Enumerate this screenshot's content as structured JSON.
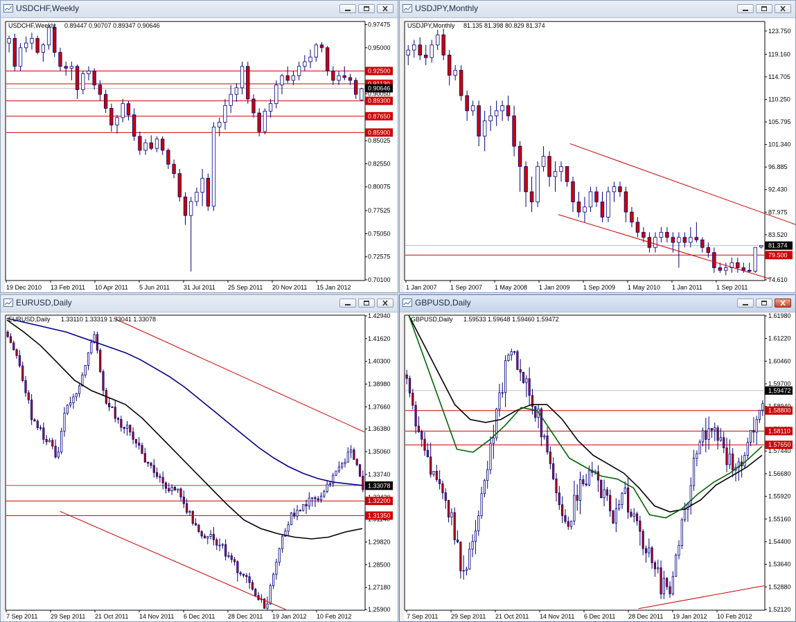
{
  "colors": {
    "level_line": "#cc0000",
    "trend_line": "#cc0000",
    "bear_body": "#cc0000",
    "bull_body": "#ffffff",
    "wick": "#000080",
    "price_tag": "#000000",
    "ma_black": "#000000",
    "ma_blue": "#00008b",
    "ma_green": "#006400"
  },
  "windows": [
    {
      "title": "USDCHF,Weekly",
      "info_symbol": "USDCHF,Weekly",
      "ohlc_text": "0.89447 0.90707 0.89347 0.90646",
      "active": false
    },
    {
      "title": "USDJPY,Monthly",
      "info_symbol": "USDJPY,Monthly",
      "ohlc_text": "81.135 81.398 80.829 81.374",
      "active": false
    },
    {
      "title": "EURUSD,Daily",
      "info_symbol": "EURUSD,Daily",
      "ohlc_text": "1.33110 1.33319 1.33041 1.33078",
      "active": false
    },
    {
      "title": "GBPUSD,Daily",
      "info_symbol": "GBPUSD,Daily",
      "ohlc_text": "1.59533 1.59648 1.59460 1.59472",
      "active": true
    }
  ],
  "chart_data": [
    {
      "type": "candlestick",
      "symbol": "USDCHF",
      "timeframe": "Weekly",
      "ylim": [
        0.701,
        0.9774
      ],
      "y_ticks": [
        "0.97475",
        "0.95000",
        "0.92500",
        "0.90050",
        "0.87750",
        "0.85025",
        "0.82550",
        "0.80075",
        "0.77525",
        "0.75050",
        "0.72575",
        "0.70100"
      ],
      "x_ticks": [
        "19 Dec 2010",
        "13 Feb 2011",
        "10 Apr 2011",
        "5 Jun 2011",
        "31 Jul 2011",
        "25 Sep 2011",
        "20 Nov 2011",
        "15 Jan 2012"
      ],
      "levels": [
        {
          "value": 0.925,
          "label": "0.92500"
        },
        {
          "value": 0.9113,
          "label": "0.91130"
        },
        {
          "value": 0.893,
          "label": "0.89300"
        },
        {
          "value": 0.8765,
          "label": "0.87650"
        },
        {
          "value": 0.859,
          "label": "0.85900"
        }
      ],
      "trendlines": [],
      "current_price": 0.90646,
      "candles": [
        [
          0.955,
          0.963,
          0.945,
          0.96
        ],
        [
          0.96,
          0.965,
          0.925,
          0.93
        ],
        [
          0.93,
          0.955,
          0.925,
          0.95
        ],
        [
          0.95,
          0.962,
          0.945,
          0.955
        ],
        [
          0.955,
          0.966,
          0.948,
          0.96
        ],
        [
          0.96,
          0.963,
          0.943,
          0.945
        ],
        [
          0.945,
          0.955,
          0.935,
          0.953
        ],
        [
          0.953,
          0.975,
          0.948,
          0.972
        ],
        [
          0.972,
          0.976,
          0.94,
          0.945
        ],
        [
          0.945,
          0.95,
          0.925,
          0.93
        ],
        [
          0.93,
          0.935,
          0.92,
          0.928
        ],
        [
          0.928,
          0.935,
          0.915,
          0.93
        ],
        [
          0.93,
          0.932,
          0.895,
          0.905
        ],
        [
          0.905,
          0.925,
          0.9,
          0.922
        ],
        [
          0.922,
          0.93,
          0.915,
          0.925
        ],
        [
          0.925,
          0.928,
          0.905,
          0.91
        ],
        [
          0.91,
          0.915,
          0.893,
          0.9
        ],
        [
          0.9,
          0.905,
          0.88,
          0.885
        ],
        [
          0.885,
          0.89,
          0.86,
          0.867
        ],
        [
          0.867,
          0.878,
          0.858,
          0.875
        ],
        [
          0.875,
          0.895,
          0.87,
          0.89
        ],
        [
          0.89,
          0.893,
          0.872,
          0.878
        ],
        [
          0.878,
          0.885,
          0.85,
          0.855
        ],
        [
          0.855,
          0.86,
          0.835,
          0.84
        ],
        [
          0.84,
          0.852,
          0.835,
          0.848
        ],
        [
          0.848,
          0.856,
          0.84,
          0.842
        ],
        [
          0.842,
          0.855,
          0.838,
          0.852
        ],
        [
          0.852,
          0.855,
          0.835,
          0.84
        ],
        [
          0.84,
          0.842,
          0.82,
          0.825
        ],
        [
          0.825,
          0.83,
          0.81,
          0.815
        ],
        [
          0.815,
          0.82,
          0.785,
          0.79
        ],
        [
          0.79,
          0.795,
          0.76,
          0.77
        ],
        [
          0.77,
          0.79,
          0.71,
          0.785
        ],
        [
          0.785,
          0.8,
          0.78,
          0.795
        ],
        [
          0.795,
          0.82,
          0.78,
          0.81
        ],
        [
          0.81,
          0.815,
          0.775,
          0.78
        ],
        [
          0.78,
          0.87,
          0.775,
          0.865
        ],
        [
          0.865,
          0.875,
          0.855,
          0.87
        ],
        [
          0.87,
          0.895,
          0.862,
          0.888
        ],
        [
          0.888,
          0.91,
          0.88,
          0.9
        ],
        [
          0.9,
          0.912,
          0.892,
          0.907
        ],
        [
          0.907,
          0.935,
          0.9,
          0.93
        ],
        [
          0.93,
          0.935,
          0.89,
          0.895
        ],
        [
          0.895,
          0.9,
          0.875,
          0.88
        ],
        [
          0.88,
          0.885,
          0.855,
          0.86
        ],
        [
          0.86,
          0.885,
          0.857,
          0.882
        ],
        [
          0.882,
          0.895,
          0.875,
          0.89
        ],
        [
          0.89,
          0.915,
          0.885,
          0.91
        ],
        [
          0.91,
          0.922,
          0.9,
          0.92
        ],
        [
          0.92,
          0.93,
          0.912,
          0.915
        ],
        [
          0.915,
          0.925,
          0.91,
          0.92
        ],
        [
          0.92,
          0.935,
          0.915,
          0.93
        ],
        [
          0.93,
          0.942,
          0.925,
          0.935
        ],
        [
          0.935,
          0.948,
          0.928,
          0.94
        ],
        [
          0.94,
          0.955,
          0.935,
          0.953
        ],
        [
          0.953,
          0.956,
          0.945,
          0.95
        ],
        [
          0.95,
          0.952,
          0.92,
          0.925
        ],
        [
          0.925,
          0.93,
          0.91,
          0.915
        ],
        [
          0.915,
          0.925,
          0.91,
          0.92
        ],
        [
          0.92,
          0.93,
          0.915,
          0.918
        ],
        [
          0.918,
          0.922,
          0.91,
          0.915
        ],
        [
          0.915,
          0.918,
          0.895,
          0.9
        ],
        [
          0.894,
          0.907,
          0.893,
          0.906
        ]
      ]
    },
    {
      "type": "candlestick",
      "symbol": "USDJPY",
      "timeframe": "Monthly",
      "ylim": [
        74.61,
        125.5
      ],
      "y_ticks": [
        "123.750",
        "119.160",
        "114.705",
        "110.250",
        "105.795",
        "101.340",
        "96.885",
        "92.430",
        "87.975",
        "83.520",
        "79.065",
        "74.610"
      ],
      "x_ticks": [
        "1 Jan 2007",
        "1 Sep 2007",
        "1 May 2008",
        "1 Jan 2009",
        "1 Sep 2009",
        "1 May 2010",
        "1 Jan 2011",
        "1 Sep 2011"
      ],
      "levels": [
        {
          "value": 79.5,
          "label": "79.500"
        }
      ],
      "trendlines": [
        [
          [
            28,
            101.5
          ],
          [
            70,
            84
          ]
        ],
        [
          [
            26,
            87.5
          ],
          [
            62,
            74.8
          ]
        ]
      ],
      "current_price": 81.374,
      "candles": [
        [
          119,
          121,
          117,
          120
        ],
        [
          120,
          122,
          118.5,
          121
        ],
        [
          121,
          122.5,
          118,
          119
        ],
        [
          119,
          121,
          117,
          118.5
        ],
        [
          118.5,
          122,
          117.5,
          121
        ],
        [
          121,
          124,
          120,
          123
        ],
        [
          123,
          124.2,
          118,
          119
        ],
        [
          119,
          120,
          113,
          115
        ],
        [
          115,
          117,
          114,
          116
        ],
        [
          116,
          117,
          110,
          111
        ],
        [
          111,
          112,
          106,
          108
        ],
        [
          108,
          110,
          107,
          109
        ],
        [
          109,
          110,
          101,
          103
        ],
        [
          103,
          108,
          100,
          106
        ],
        [
          106,
          109,
          104,
          107
        ],
        [
          107,
          110,
          105,
          108
        ],
        [
          108,
          110,
          106,
          109
        ],
        [
          109,
          111,
          106,
          107
        ],
        [
          107,
          109,
          99,
          101
        ],
        [
          101,
          102,
          92,
          97
        ],
        [
          97,
          98,
          89,
          92
        ],
        [
          92,
          95,
          88,
          90
        ],
        [
          90,
          98,
          89,
          97
        ],
        [
          97,
          101,
          96,
          99
        ],
        [
          99,
          100,
          93,
          95
        ],
        [
          95,
          98,
          92,
          96
        ],
        [
          96,
          98,
          94,
          97
        ],
        [
          97,
          97,
          93,
          94
        ],
        [
          94,
          95,
          88,
          90
        ],
        [
          90,
          92,
          87,
          88
        ],
        [
          88,
          91,
          86,
          89
        ],
        [
          89,
          93,
          88,
          92
        ],
        [
          92,
          93,
          89,
          90
        ],
        [
          90,
          92,
          86,
          87
        ],
        [
          87,
          93,
          86,
          92
        ],
        [
          92,
          94,
          90,
          93
        ],
        [
          93,
          94,
          91,
          92
        ],
        [
          92,
          93,
          86,
          88
        ],
        [
          88,
          89,
          85,
          86
        ],
        [
          86,
          87,
          83,
          84
        ],
        [
          84,
          85,
          82,
          83
        ],
        [
          83,
          84,
          80,
          81
        ],
        [
          81,
          84,
          80,
          83
        ],
        [
          83,
          85,
          82,
          84
        ],
        [
          84,
          85,
          82,
          83
        ],
        [
          83,
          84,
          80,
          82
        ],
        [
          82,
          84,
          77,
          83
        ],
        [
          83,
          84,
          81,
          82
        ],
        [
          82,
          85,
          81,
          83
        ],
        [
          83,
          86,
          82,
          82.5
        ],
        [
          82.5,
          83,
          80,
          81
        ],
        [
          81,
          82,
          79,
          80
        ],
        [
          80,
          81,
          76,
          77
        ],
        [
          77,
          78,
          76,
          76.5
        ],
        [
          76.5,
          78,
          75.5,
          77
        ],
        [
          77,
          79,
          76,
          78
        ],
        [
          78,
          79,
          76,
          77
        ],
        [
          77,
          78,
          76,
          76.5
        ],
        [
          76.5,
          78,
          76,
          76.3
        ],
        [
          76.3,
          81,
          76,
          81
        ],
        [
          81.1,
          81.4,
          80.8,
          81.37
        ]
      ]
    },
    {
      "type": "candlestick",
      "symbol": "EURUSD",
      "timeframe": "Daily",
      "ylim": [
        1.259,
        1.4294
      ],
      "y_ticks": [
        "1.42940",
        "1.41620",
        "1.40300",
        "1.38980",
        "1.37660",
        "1.36380",
        "1.35060",
        "1.33740",
        "1.32420",
        "1.31140",
        "1.29820",
        "1.28500",
        "1.27180",
        "1.25900"
      ],
      "x_ticks": [
        "7 Sep 2011",
        "29 Sep 2011",
        "21 Oct 2011",
        "14 Nov 2011",
        "6 Dec 2011",
        "28 Dec 2011",
        "19 Jan 2012",
        "10 Feb 2012"
      ],
      "levels": [
        {
          "value": 1.331,
          "label": "1.33100"
        },
        {
          "value": 1.322,
          "label": "1.32200"
        },
        {
          "value": 1.3135,
          "label": "1.31350"
        }
      ],
      "trendlines": [
        [
          [
            0.3,
            1.428
          ],
          [
            1,
            1.362
          ]
        ],
        [
          [
            0.15,
            1.316
          ],
          [
            0.78,
            1.259
          ]
        ]
      ],
      "current_price": 1.33078,
      "ma_series": [
        {
          "color": "#00008b",
          "values": [
            1.428,
            1.426,
            1.424,
            1.422,
            1.42,
            1.417,
            1.414,
            1.411,
            1.408,
            1.404,
            1.399,
            1.394,
            1.388,
            1.381,
            1.374,
            1.367,
            1.36,
            1.353,
            1.347,
            1.342,
            1.338,
            1.335,
            1.333,
            1.332,
            1.331
          ]
        },
        {
          "color": "#000000",
          "values": [
            1.427,
            1.42,
            1.412,
            1.402,
            1.392,
            1.386,
            1.382,
            1.378,
            1.37,
            1.36,
            1.35,
            1.34,
            1.33,
            1.32,
            1.311,
            1.306,
            1.303,
            1.301,
            1.3,
            1.301,
            1.304,
            1.306
          ]
        }
      ]
    },
    {
      "type": "candlestick",
      "symbol": "GBPUSD",
      "timeframe": "Daily",
      "ylim": [
        1.5212,
        1.6198
      ],
      "y_ticks": [
        "1.61980",
        "1.61220",
        "1.60460",
        "1.59700",
        "1.58940",
        "1.58180",
        "1.57440",
        "1.56680",
        "1.55920",
        "1.55160",
        "1.54400",
        "1.53640",
        "1.52880",
        "1.52120"
      ],
      "x_ticks": [
        "7 Sep 2011",
        "29 Sep 2011",
        "21 Oct 2011",
        "14 Nov 2011",
        "6 Dec 2011",
        "28 Dec 2011",
        "19 Jan 2012",
        "10 Feb 2012"
      ],
      "levels": [
        {
          "value": 1.588,
          "label": "1.58800"
        },
        {
          "value": 1.5811,
          "label": "1.58110"
        },
        {
          "value": 1.5765,
          "label": "1.57650"
        }
      ],
      "trendlines": [
        [
          [
            0.65,
            1.5215
          ],
          [
            1,
            1.5292
          ]
        ]
      ],
      "current_price": 1.59472,
      "ma_series": [
        {
          "color": "#000000",
          "values": [
            1.62,
            1.61,
            1.6,
            1.59,
            1.585,
            1.584,
            1.585,
            1.588,
            1.59,
            1.59,
            1.585,
            1.578,
            1.573,
            1.57,
            1.567,
            1.562,
            1.556,
            1.554,
            1.555,
            1.558,
            1.563,
            1.566,
            1.569,
            1.573
          ]
        },
        {
          "color": "#006400",
          "values": [
            1.62,
            1.605,
            1.59,
            1.575,
            1.574,
            1.578,
            1.583,
            1.589,
            1.588,
            1.58,
            1.572,
            1.569,
            1.566,
            1.565,
            1.562,
            1.553,
            1.552,
            1.555,
            1.56,
            1.564,
            1.567,
            1.571,
            1.576
          ]
        }
      ]
    }
  ]
}
